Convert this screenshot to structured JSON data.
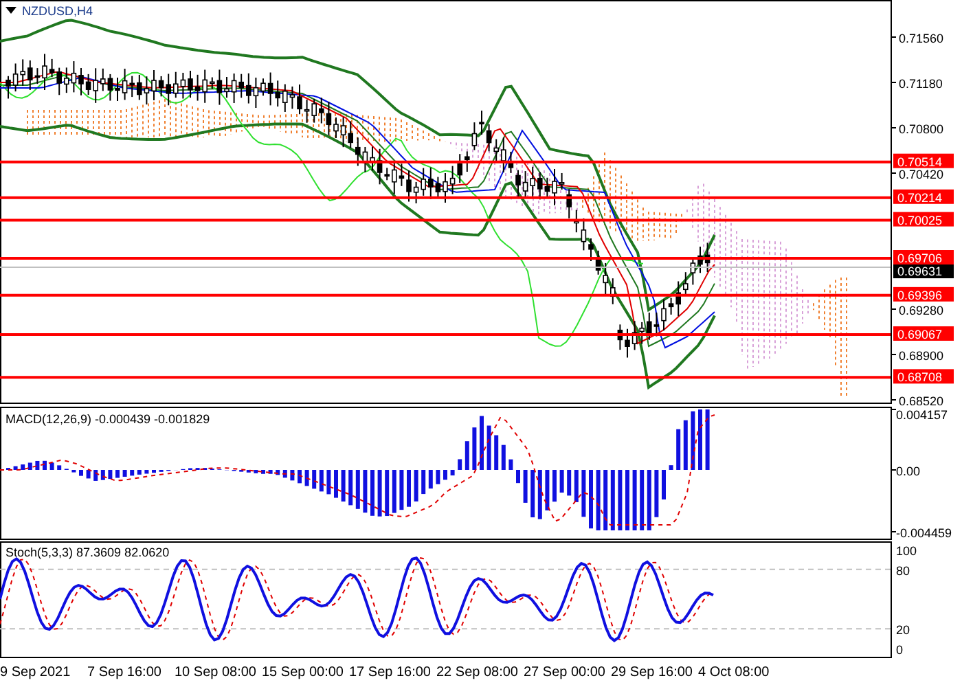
{
  "symbol": {
    "label": "NZDUSD,H4"
  },
  "price_axis": {
    "ticks": [
      "0.71560",
      "0.71180",
      "0.70800",
      "0.70420",
      "0.69280",
      "0.68900",
      "0.68520"
    ]
  },
  "levels": [
    {
      "price": "0.70514"
    },
    {
      "price": "0.70214"
    },
    {
      "price": "0.70025"
    },
    {
      "price": "0.69706"
    },
    {
      "price": "0.69396"
    },
    {
      "price": "0.69067"
    },
    {
      "price": "0.68708"
    }
  ],
  "current_price": "0.69631",
  "macd": {
    "label": "MACD(12,26,9) -0.000439 -0.001829",
    "ticks": [
      "0.004157",
      "0.00",
      "-0.004459"
    ]
  },
  "stoch": {
    "label": "Stoch(5,3,3) 87.3609 82.0620",
    "ticks": [
      "100",
      "80",
      "20",
      "0"
    ]
  },
  "time_axis": [
    "9 Sep 2021",
    "7 Sep 16:00",
    "10 Sep 08:00",
    "15 Sep 00:00",
    "17 Sep 16:00",
    "22 Sep 08:00",
    "27 Sep 00:00",
    "29 Sep 16:00",
    "4 Oct 08:00"
  ]
}
